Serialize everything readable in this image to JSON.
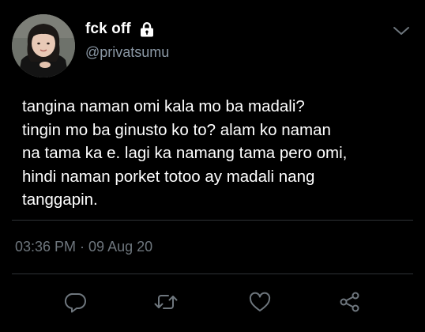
{
  "author": {
    "display_name": "fck off",
    "handle": "@privatsumu",
    "protected": true
  },
  "tweet": {
    "text": "tangina naman omi kala mo ba madali?\ntingin mo ba ginusto ko to? alam ko naman\nna tama ka e. lagi ka namang tama pero omi,\nhindi naman porket totoo ay madali nang\ntanggapin.",
    "timestamp": "03:36 PM · 09 Aug 20"
  },
  "icons": {
    "avatar": "avatar-photo",
    "lock": "lock-icon",
    "more": "chevron-down-icon",
    "reply": "reply-icon",
    "retweet": "retweet-icon",
    "like": "heart-icon",
    "share": "share-icon"
  },
  "colors": {
    "background": "#000000",
    "primary_text": "#ffffff",
    "secondary_text": "#8b98a5",
    "icon": "#6e767d",
    "divider": "#2f3336"
  }
}
